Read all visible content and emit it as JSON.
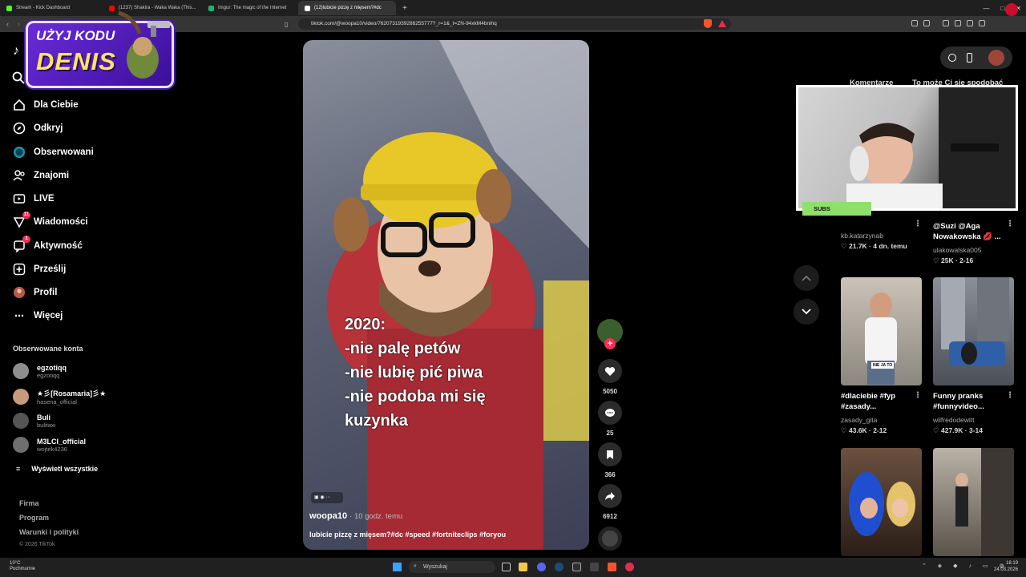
{
  "browser": {
    "tabs": [
      {
        "label": "Stream - Kick Dashboard",
        "color": "#53fc18"
      },
      {
        "label": "(1237) Shakira - Waka Waka (This...",
        "color": "#ff0000"
      },
      {
        "label": "Imgur: The magic of the Internet",
        "color": "#1bb76e"
      },
      {
        "label": "(12)lubicie pizzę z mięsem?#dc",
        "color": "#ffffff"
      }
    ],
    "new_tab": "+",
    "url": "tiktok.com/@woopa10/video/7620731939288255777?_r=1&_t=ZN-94xkM4bnihq"
  },
  "promo": {
    "line1": "UŻYJ KODU",
    "line2": "DENIS"
  },
  "sidebar": {
    "logo": "♪",
    "nav": [
      {
        "label": "Dla Ciebie",
        "icon": "home-icon"
      },
      {
        "label": "Odkryj",
        "icon": "compass-icon"
      },
      {
        "label": "Obserwowani",
        "icon": "following-icon"
      },
      {
        "label": "Znajomi",
        "icon": "friends-icon"
      },
      {
        "label": "LIVE",
        "icon": "live-icon"
      },
      {
        "label": "Wiadomości",
        "icon": "messages-icon",
        "badge": "11"
      },
      {
        "label": "Aktywność",
        "icon": "activity-icon",
        "badge": "1"
      },
      {
        "label": "Prześlij",
        "icon": "upload-icon"
      },
      {
        "label": "Profil",
        "icon": "profile-icon"
      },
      {
        "label": "Więcej",
        "icon": "more-icon"
      }
    ],
    "followed_title": "Obserwowane konta",
    "followed": [
      {
        "name": "egzotiqq",
        "user": "egzotiqq"
      },
      {
        "name": "★彡[Rosamaria]彡★",
        "user": "hasena_official"
      },
      {
        "name": "Buli",
        "user": "bulitaxi"
      },
      {
        "name": "M3LCI_official",
        "user": "wojtek4236"
      }
    ],
    "see_all": "Wyświetl wszystkie",
    "footer": [
      "Firma",
      "Program",
      "Warunki i polityki"
    ],
    "copyright": "© 2026 TikTok"
  },
  "video": {
    "overlay_text": "2020:\n-nie palę petów\n-nie lubię pić piwa\n-nie podoba mi się\nkuzynka",
    "author": "woopa10",
    "time": "· 10 godz. temu",
    "caption": "lubicie pizzę z mięsem?#dc #speed #fortniteclips #foryou"
  },
  "actions": {
    "likes": "5050",
    "comments": "25",
    "saves": "366",
    "shares": "6912"
  },
  "right_panel": {
    "tabs": [
      "Komentarze",
      "To może Ci się spodobać"
    ],
    "subs_label": "SUBS",
    "cards": [
      {
        "title": "",
        "user": "kb.katarzynab",
        "likes": "21.7K",
        "date": "4 dn. temu"
      },
      {
        "title": "@Suzi @Aga Nowakowska 💋 ...",
        "user": "ulakowalska005",
        "likes": "25K",
        "date": "2-16"
      },
      {
        "title": "#dlaciebie #fyp #zasady...",
        "user": "zasady_gita",
        "likes": "43.6K",
        "date": "2-12"
      },
      {
        "title": "Funny pranks #funnyvideo...",
        "user": "wilfredodewitt",
        "likes": "427.9K",
        "date": "3-14"
      }
    ],
    "thumb_caption": "NIE JA TO"
  },
  "taskbar": {
    "weather_temp": "10°C",
    "weather_desc": "Pochmurnie",
    "search": "Wyszukaj",
    "time": "18:19",
    "date": "24.03.2026"
  },
  "colors": {
    "accent": "#fe2c55",
    "promo_yellow": "#ffe55c",
    "promo_purple": "#6a2bd8",
    "subs_green": "#8fe06b"
  }
}
